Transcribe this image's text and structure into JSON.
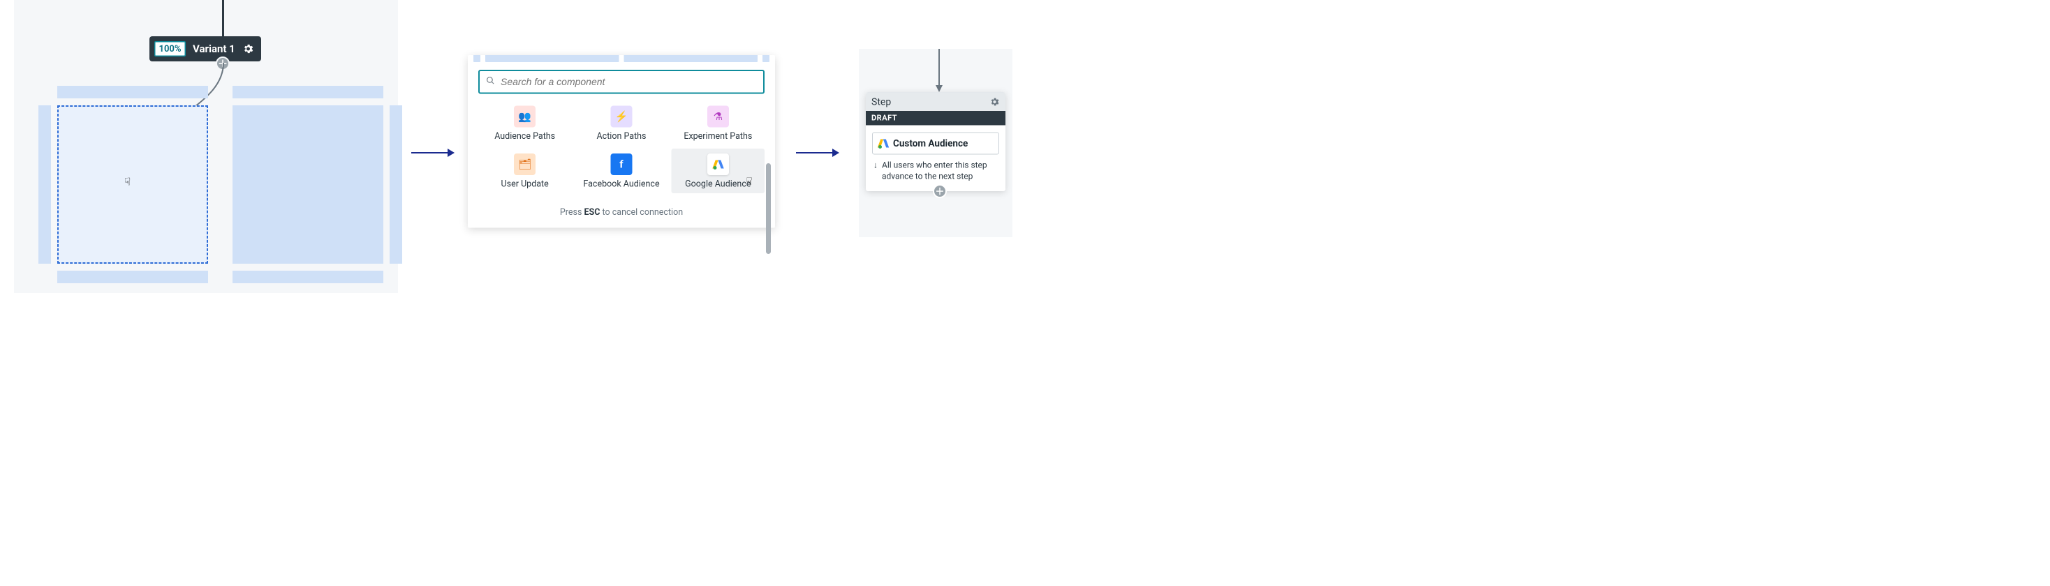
{
  "panel1": {
    "variant_percent": "100%",
    "variant_name": "Variant 1"
  },
  "picker": {
    "search_placeholder": "Search for a component",
    "hint_pre": "Press ",
    "hint_key": "ESC",
    "hint_post": " to cancel connection",
    "items": [
      {
        "label": "Audience Paths"
      },
      {
        "label": "Action Paths"
      },
      {
        "label": "Experiment Paths"
      },
      {
        "label": "User Update"
      },
      {
        "label": "Facebook Audience"
      },
      {
        "label": "Google Audience"
      }
    ]
  },
  "step": {
    "title": "Step",
    "badge": "DRAFT",
    "chip_label": "Custom Audience",
    "note": "All users who enter this step advance to the next step"
  }
}
